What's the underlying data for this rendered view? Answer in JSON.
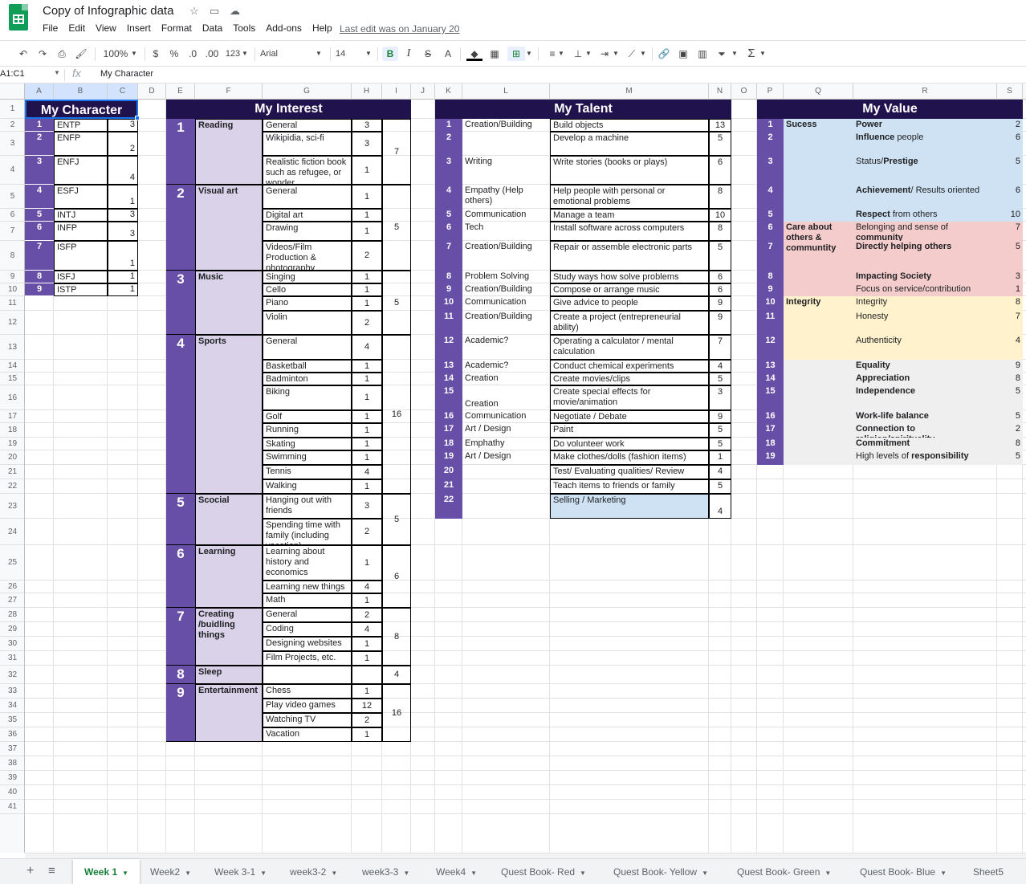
{
  "app": {
    "title": "Copy of Infographic data",
    "menus": [
      "File",
      "Edit",
      "View",
      "Insert",
      "Format",
      "Data",
      "Tools",
      "Add-ons",
      "Help"
    ],
    "last_edit": "Last edit was on January 20"
  },
  "toolbar": {
    "zoom": "100%",
    "currency": "$",
    "percent": "%",
    "dec_decrease": ".0",
    "dec_increase": ".00",
    "more_formats": "123",
    "font": "Arial",
    "font_size": "14",
    "bold": "B",
    "italic": "I",
    "strike": "S",
    "text_color": "A"
  },
  "formula_bar": {
    "name_box": "A1:C1",
    "fx": "fx",
    "value": "My Character"
  },
  "columns": [
    "A",
    "B",
    "C",
    "D",
    "E",
    "F",
    "G",
    "H",
    "I",
    "J",
    "K",
    "L",
    "M",
    "N",
    "O",
    "P",
    "Q",
    "R",
    "S"
  ],
  "rows": [
    "1",
    "2",
    "3",
    "4",
    "5",
    "6",
    "7",
    "8",
    "9",
    "10",
    "11",
    "12",
    "13",
    "14",
    "15",
    "16",
    "17",
    "18",
    "19",
    "20",
    "21",
    "22",
    "23",
    "24",
    "25",
    "26",
    "27",
    "28",
    "29",
    "30",
    "31",
    "32",
    "33",
    "34",
    "35",
    "36",
    "37",
    "38",
    "39",
    "40",
    "41"
  ],
  "colors": {
    "header_bg": "#20124d",
    "purple": "#674ea7",
    "light_purple": "#d9d2e9",
    "blue": "#cfe2f3",
    "red": "#f4cccc",
    "yellow": "#fff2cc",
    "gray": "#efefef",
    "active_tab": "#188038"
  },
  "character": {
    "title": "My Character",
    "rows": [
      {
        "n": "1",
        "type": "ENTP",
        "count": "3"
      },
      {
        "n": "2",
        "type": "ENFP",
        "count": "2"
      },
      {
        "n": "3",
        "type": "ENFJ",
        "count": "4"
      },
      {
        "n": "4",
        "type": "ESFJ",
        "count": "1"
      },
      {
        "n": "5",
        "type": "INTJ",
        "count": "3"
      },
      {
        "n": "6",
        "type": "INFP",
        "count": "3"
      },
      {
        "n": "7",
        "type": "ISFP",
        "count": "1"
      },
      {
        "n": "8",
        "type": "ISFJ",
        "count": "1"
      },
      {
        "n": "9",
        "type": "ISTP",
        "count": "1"
      }
    ]
  },
  "interest": {
    "title": "My Interest",
    "groups": [
      {
        "n": "1",
        "name": "Reading",
        "total": "7",
        "items": [
          {
            "l": "General",
            "c": "3"
          },
          {
            "l": "Wikipidia, sci-fi",
            "c": "3"
          },
          {
            "l": "Realistic fiction book such as refugee, or wonder",
            "c": "1"
          }
        ]
      },
      {
        "n": "2",
        "name": "Visual art",
        "total": "5",
        "items": [
          {
            "l": "General",
            "c": "1"
          },
          {
            "l": "Digital art",
            "c": "1"
          },
          {
            "l": "Drawing",
            "c": "1"
          },
          {
            "l": "Videos/Film Production & photography",
            "c": "2"
          }
        ]
      },
      {
        "n": "3",
        "name": "Music",
        "total": "5",
        "items": [
          {
            "l": "Singing",
            "c": "1"
          },
          {
            "l": "Cello",
            "c": "1"
          },
          {
            "l": "Piano",
            "c": "1"
          },
          {
            "l": "Violin",
            "c": "2"
          }
        ]
      },
      {
        "n": "4",
        "name": "Sports",
        "total": "16",
        "items": [
          {
            "l": "General",
            "c": "4"
          },
          {
            "l": "Basketball",
            "c": "1"
          },
          {
            "l": "Badminton",
            "c": "1"
          },
          {
            "l": "Biking",
            "c": "1"
          },
          {
            "l": "Golf",
            "c": "1"
          },
          {
            "l": "Running",
            "c": "1"
          },
          {
            "l": "Skating",
            "c": "1"
          },
          {
            "l": "Swimming",
            "c": "1"
          },
          {
            "l": "Tennis",
            "c": "4"
          },
          {
            "l": "Walking",
            "c": "1"
          }
        ]
      },
      {
        "n": "5",
        "name": "Scocial",
        "total": "5",
        "items": [
          {
            "l": "Hanging out with friends",
            "c": "3"
          },
          {
            "l": "Spending time with family (including vacation)",
            "c": "2"
          }
        ]
      },
      {
        "n": "6",
        "name": "Learning",
        "total": "6",
        "items": [
          {
            "l": "Learning about history and economics",
            "c": "1"
          },
          {
            "l": "Learning new things",
            "c": "4"
          },
          {
            "l": "Math",
            "c": "1"
          }
        ]
      },
      {
        "n": "7",
        "name": "Creating /buidling things",
        "total": "8",
        "items": [
          {
            "l": "General",
            "c": "2"
          },
          {
            "l": "Coding",
            "c": "4"
          },
          {
            "l": "Designing websites",
            "c": "1"
          },
          {
            "l": "Film Projects, etc.",
            "c": "1"
          }
        ]
      },
      {
        "n": "8",
        "name": "Sleep",
        "total": "4",
        "items": [
          {
            "l": "",
            "c": ""
          }
        ]
      },
      {
        "n": "9",
        "name": "Entertainment",
        "total": "16",
        "items": [
          {
            "l": "Chess",
            "c": "1"
          },
          {
            "l": "Play video games",
            "c": "12"
          },
          {
            "l": "Watching TV",
            "c": "2"
          },
          {
            "l": "Vacation",
            "c": "1"
          }
        ]
      }
    ]
  },
  "talent": {
    "title": "My Talent",
    "rows": [
      {
        "n": "1",
        "cat": "Creation/Building",
        "desc": "Build objects",
        "c": "13"
      },
      {
        "n": "2",
        "cat": "",
        "desc": "Develop a machine",
        "c": "5"
      },
      {
        "n": "3",
        "cat": "Writing",
        "desc": "Write stories (books or plays)",
        "c": "6"
      },
      {
        "n": "4",
        "cat": "Empathy (Help others)",
        "desc": "Help people with personal or emotional problems",
        "c": "8"
      },
      {
        "n": "5",
        "cat": "Communication",
        "desc": "Manage a team",
        "c": "10"
      },
      {
        "n": "6",
        "cat": "Tech",
        "desc": "Install software across computers",
        "c": "8"
      },
      {
        "n": "7",
        "cat": "Creation/Building",
        "desc": "Repair or assemble electronic parts",
        "c": "5"
      },
      {
        "n": "8",
        "cat": "Problem Solving",
        "desc": "Study ways how solve problems",
        "c": "6"
      },
      {
        "n": "9",
        "cat": "Creation/Building",
        "desc": "Compose or arrange music",
        "c": "6"
      },
      {
        "n": "10",
        "cat": "Communication",
        "desc": "Give advice to people",
        "c": "9"
      },
      {
        "n": "11",
        "cat": "Creation/Building",
        "desc": "Create a project (entrepreneurial ability)",
        "c": "9"
      },
      {
        "n": "12",
        "cat": "Academic?",
        "desc": "Operating a calculator / mental calculation",
        "c": "7"
      },
      {
        "n": "13",
        "cat": "Academic?",
        "desc": "Conduct chemical experiments",
        "c": "4"
      },
      {
        "n": "14",
        "cat": "Creation",
        "desc": "Create movies/clips",
        "c": "5"
      },
      {
        "n": "15",
        "cat": "Creation",
        "desc": "Create special effects for movie/animation",
        "c": "3"
      },
      {
        "n": "16",
        "cat": "Communication",
        "desc": "Negotiate / Debate",
        "c": "9"
      },
      {
        "n": "17",
        "cat": "Art / Design",
        "desc": "Paint",
        "c": "5"
      },
      {
        "n": "18",
        "cat": "Emphathy",
        "desc": "Do volunteer work",
        "c": "5"
      },
      {
        "n": "19",
        "cat": "Art / Design",
        "desc": "Make clothes/dolls (fashion items)",
        "c": "1"
      },
      {
        "n": "20",
        "cat": "",
        "desc": "Test/ Evaluating qualities/ Review",
        "c": "4"
      },
      {
        "n": "21",
        "cat": "",
        "desc": "Teach items to friends or family",
        "c": "5"
      },
      {
        "n": "22",
        "cat": "",
        "desc": "Selling / Marketing",
        "c": "4"
      }
    ]
  },
  "value": {
    "title": "My Value",
    "groups": [
      {
        "name": "Sucess",
        "color": "#cfe2f3"
      },
      {
        "name": "Care about others & communtity",
        "color": "#f4cccc"
      },
      {
        "name": "Integrity",
        "color": "#fff2cc"
      },
      {
        "name": "",
        "color": "#efefef"
      }
    ],
    "rows": [
      {
        "n": "1",
        "bold": "Power",
        "rest": "",
        "c": "2"
      },
      {
        "n": "2",
        "bold": "Influence",
        "rest": " people",
        "c": "6"
      },
      {
        "n": "3",
        "pre": "Status/",
        "bold": "Prestige",
        "rest": "",
        "c": "5"
      },
      {
        "n": "4",
        "bold": "Achievement",
        "rest": "/ Results oriented",
        "c": "6"
      },
      {
        "n": "5",
        "bold": "Respect",
        "rest": " from others",
        "c": "10"
      },
      {
        "n": "6",
        "pre": "Belonging and sense of ",
        "bold": "",
        "rest": "",
        "c": "7"
      },
      {
        "n": "7",
        "bold": "Directly helping others",
        "rest": "",
        "c": "5"
      },
      {
        "n": "8",
        "bold": "Impacting Society",
        "rest": "",
        "c": "3"
      },
      {
        "n": "9",
        "pre": "Focus on service/contribution",
        "bold": "",
        "rest": "",
        "c": "1"
      },
      {
        "n": "10",
        "pre": "Integrity",
        "bold": "",
        "rest": "",
        "c": "8"
      },
      {
        "n": "11",
        "pre": "Honesty",
        "bold": "",
        "rest": "",
        "c": "7"
      },
      {
        "n": "12",
        "pre": "Authenticity",
        "bold": "",
        "rest": "",
        "c": "4"
      },
      {
        "n": "13",
        "bold": "Equality",
        "rest": "",
        "c": "9"
      },
      {
        "n": "14",
        "bold": "Appreciation",
        "rest": "",
        "c": "8"
      },
      {
        "n": "15",
        "bold": "Independence",
        "rest": "",
        "c": "5"
      },
      {
        "n": "16",
        "bold": "Work-life balance",
        "rest": "",
        "c": "5"
      },
      {
        "n": "17",
        "bold": "Connection to religion/spirituality",
        "rest": "",
        "c": "2"
      },
      {
        "n": "18",
        "bold": "Commitment",
        "rest": "",
        "c": "8"
      },
      {
        "n": "19",
        "pre": "High levels of ",
        "bold": "responsibility",
        "rest": "",
        "c": "5"
      }
    ],
    "community_word": "community"
  },
  "sheets": [
    "Week 1",
    "Week2",
    "Week 3-1",
    "week3-2",
    "week3-3",
    "Week4",
    "Quest Book- Red",
    "Quest Book- Yellow",
    "Quest Book- Green",
    "Quest Book- Blue",
    "Sheet5"
  ]
}
